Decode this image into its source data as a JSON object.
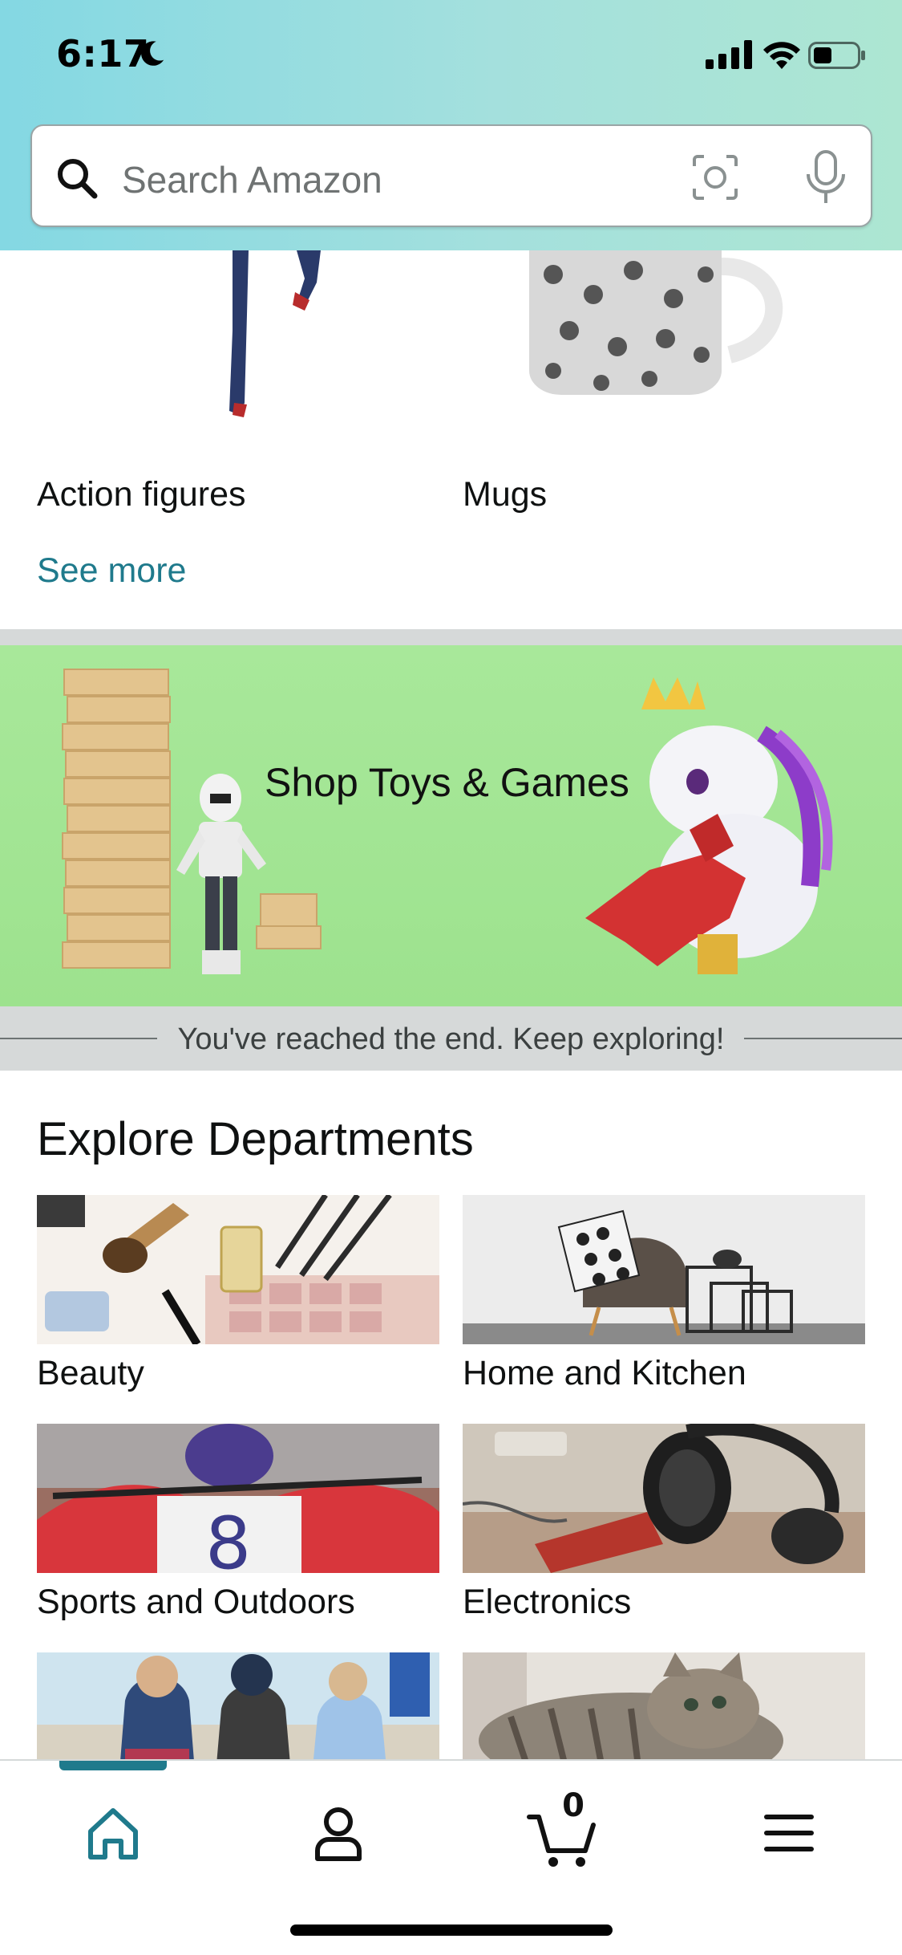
{
  "status_bar": {
    "time": "6:17"
  },
  "search": {
    "placeholder": "Search Amazon"
  },
  "top_categories": [
    {
      "label": "Action figures"
    },
    {
      "label": "Mugs"
    }
  ],
  "see_more": "See more",
  "promo": {
    "title": "Shop Toys & Games"
  },
  "end_message": "You've reached the end. Keep exploring!",
  "departments": {
    "title": "Explore Departments",
    "items": [
      {
        "label": "Beauty"
      },
      {
        "label": "Home and Kitchen"
      },
      {
        "label": "Sports and Outdoors"
      },
      {
        "label": "Electronics"
      },
      {
        "label": ""
      },
      {
        "label": ""
      }
    ]
  },
  "bottom_nav": {
    "items": [
      "home-icon",
      "account-icon",
      "cart-icon",
      "menu-icon"
    ],
    "active": "home-icon",
    "cart_count": "0"
  },
  "colors": {
    "accent": "#1f7a8c",
    "header_gradient_start": "#84d8e3",
    "header_gradient_end": "#ade6d2",
    "promo_bg": "#a8e89a"
  }
}
